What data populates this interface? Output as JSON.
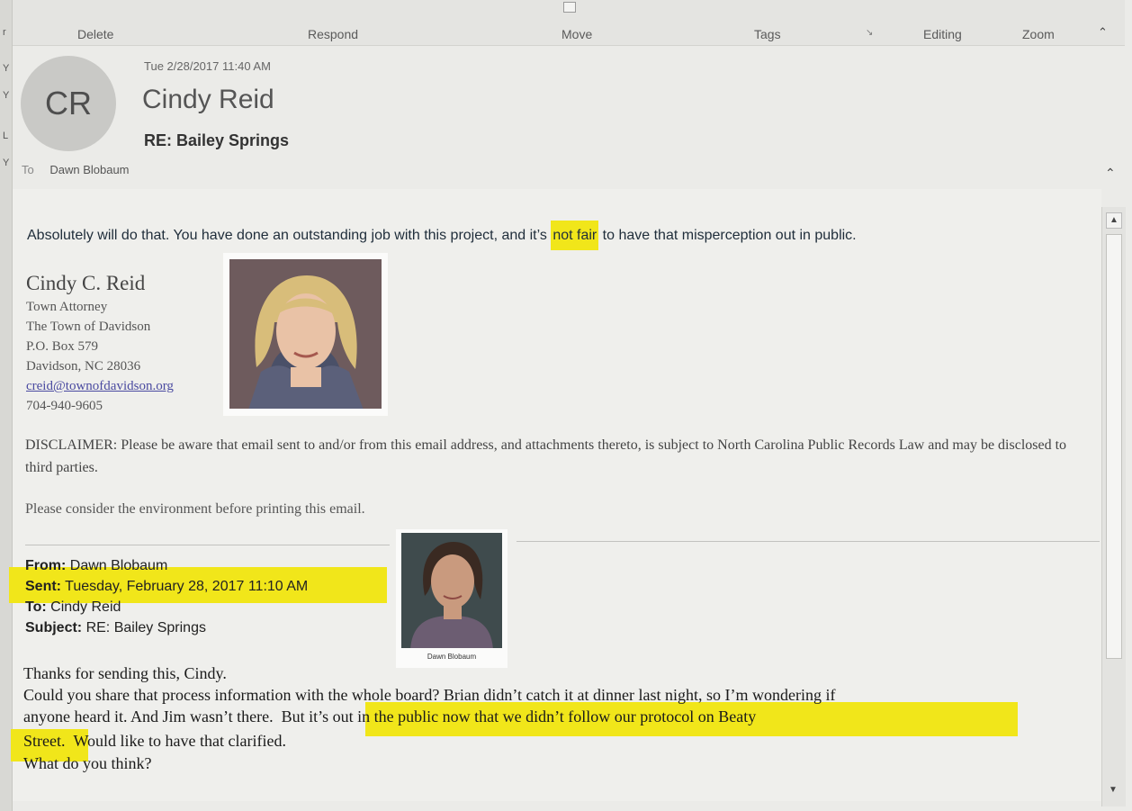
{
  "ribbon": {
    "groups": [
      "Delete",
      "Respond",
      "Move",
      "Tags",
      "Editing",
      "Zoom"
    ]
  },
  "email": {
    "avatar_initials": "CR",
    "date": "Tue 2/28/2017 11:40 AM",
    "sender": "Cindy Reid",
    "subject": "RE: Bailey Springs",
    "to_label": "To",
    "to": "Dawn Blobaum"
  },
  "body": {
    "line_before": "Absolutely will do that. You have done an outstanding  job with this project, and it’s ",
    "line_highlight": "not fair",
    "line_after": " to have that misperception out in public."
  },
  "signature": {
    "name": "Cindy C. Reid",
    "title": "Town Attorney",
    "org": "The Town of Davidson",
    "po_box": "P.O. Box 579",
    "city": "Davidson, NC 28036",
    "email": "creid@townofdavidson.org",
    "phone": "704-940-9605"
  },
  "disclaimer": {
    "text": "DISCLAIMER: Please be aware that email sent to and/or from this email address, and attachments thereto,  is subject to North Carolina Public Records Law and may be disclosed to third parties.",
    "environment": "Please consider the environment before printing this email."
  },
  "forwarded": {
    "from_label": "From:",
    "from": "Dawn Blobaum",
    "sent_label": "Sent:",
    "sent": "Tuesday, February 28, 2017 11:10 AM",
    "to_label": "To:",
    "to": "Cindy Reid",
    "subject_label": "Subject:",
    "subject": "RE: Bailey Springs",
    "photo_caption": "Dawn Blobaum"
  },
  "message": {
    "line1": "Thanks for sending this, Cindy.",
    "line2": "Could you share that process information with the whole board?  Brian didn’t catch it at dinner last night, so I’m wondering if",
    "line3_plain": "anyone heard it.  And Jim wasn’t there.",
    "line3_highlight": "But it’s out in the public now that we didn’t follow our protocol on Beaty",
    "line4_highlight": "Street.",
    "line4_plain": "Would like to have that clarified.",
    "line5": "What do you think?"
  },
  "colors": {
    "highlight": "#f1e61a",
    "link": "#4a4aa0"
  }
}
